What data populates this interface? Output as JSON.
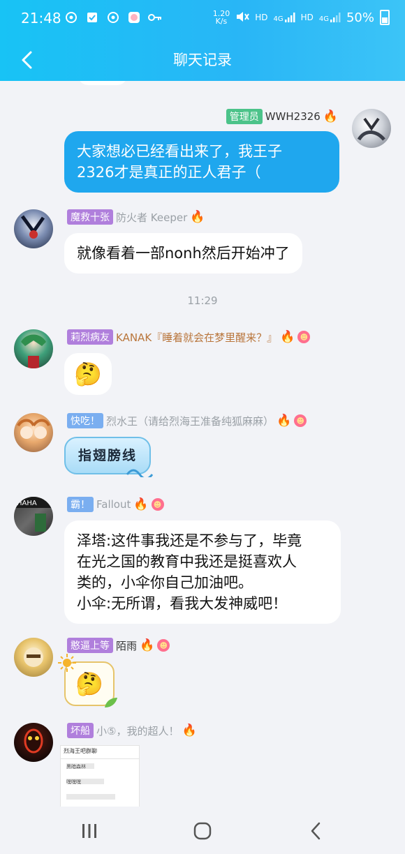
{
  "status_bar": {
    "time": "21:48",
    "net_speed_top": "1.20",
    "net_speed_unit": "K/s",
    "hd1": "HD",
    "hd2": "HD",
    "net1": "4G",
    "net2": "4G",
    "battery": "50%"
  },
  "header": {
    "title": "聊天记录"
  },
  "messages": [
    {
      "tag": "管理员",
      "tag_color": "#4cc38a",
      "name": "WWH2326",
      "name_color": "#333333",
      "text_lines": [
        "大家想必已经看出来了，我王子",
        "2326才是真正的正人君子（"
      ]
    },
    {
      "tag": "魔救十张",
      "tag_color": "#b07fdc",
      "name": "防火者 Keeper",
      "name_color": "#9aa0a6",
      "text": "就像看着一部nonh然后开始冲了"
    },
    {
      "timestamp": "11:29"
    },
    {
      "tag": "莉烈病友",
      "tag_color": "#b07fdc",
      "name": "KANAK『睡着就会在梦里醒来？』",
      "name_color": "#b9763c",
      "emoji": "🤔"
    },
    {
      "tag": "快吃！",
      "tag_color": "#7aaef0",
      "name": "烈水王（请给烈海王准备纯狐麻麻）",
      "name_color": "#9aa0a6",
      "text": "指翅膀线"
    },
    {
      "tag": "霸！",
      "tag_color": "#7aaef0",
      "name": "Fallout",
      "name_color": "#9aa0a6",
      "text_lines": [
        "泽塔:这件事我还是不参与了，毕竟",
        "在光之国的教育中我还是挺喜欢人",
        "类的，小伞你自己加油吧。",
        "小伞:无所谓，看我大发神威吧！"
      ]
    },
    {
      "tag": "憨逼上等",
      "tag_color": "#b07fdc",
      "name": "陌雨",
      "name_color": "#333333",
      "emoji": "🤔"
    },
    {
      "tag": "坏船",
      "tag_color": "#b07fdc",
      "name": "小⑤，我的超人！",
      "name_color": "#9aa0a6",
      "image_text": [
        "烈海王吧群聊",
        "黑暗森林",
        "嘿嘿嘿"
      ]
    }
  ],
  "icons": {
    "back": "chevron-left-icon",
    "flame": "🔥",
    "badge": "☻",
    "recent": "recent-apps-icon",
    "home": "home-icon",
    "nav_back": "nav-back-icon"
  }
}
